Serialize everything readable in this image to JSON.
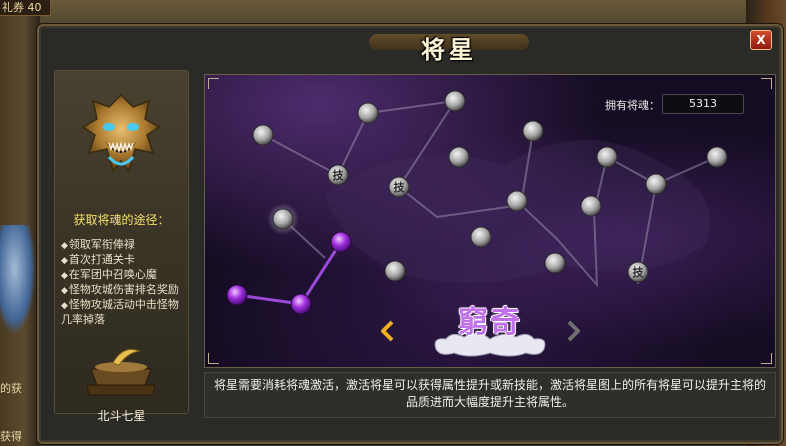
{
  "background": {
    "coupon_text": "礼券 40",
    "side_text_1": "的获",
    "side_text_2": "获得"
  },
  "window": {
    "title": "将星",
    "close_label": "X"
  },
  "sidebar": {
    "path_title": "获取将魂的途径：",
    "paths": [
      "领取军衔俸禄",
      "首次打通关卡",
      "在军团中召唤心魔",
      "怪物攻城伤害排名奖励",
      "怪物攻城活动中击怪物几率掉落"
    ],
    "item_label": "北斗七星"
  },
  "star_map": {
    "soul_label": "拥有将魂：",
    "soul_value": "5313",
    "group_name": "窮奇",
    "skill_node_label": "技",
    "colors": {
      "active": "#b04ae8",
      "inactive": "#bdbdbd",
      "selected": "#e0e0e0"
    }
  },
  "description": "将星需要消耗将魂激活，激活将星可以获得属性提升或新技能，激活将星图上的所有将星可以提升主将的品质进而大幅度提升主将属性。",
  "icons": [
    "close-icon",
    "dragon-emblem-icon",
    "bowl-icon",
    "chevron-left-icon",
    "chevron-right-icon",
    "cloud-ornament"
  ]
}
